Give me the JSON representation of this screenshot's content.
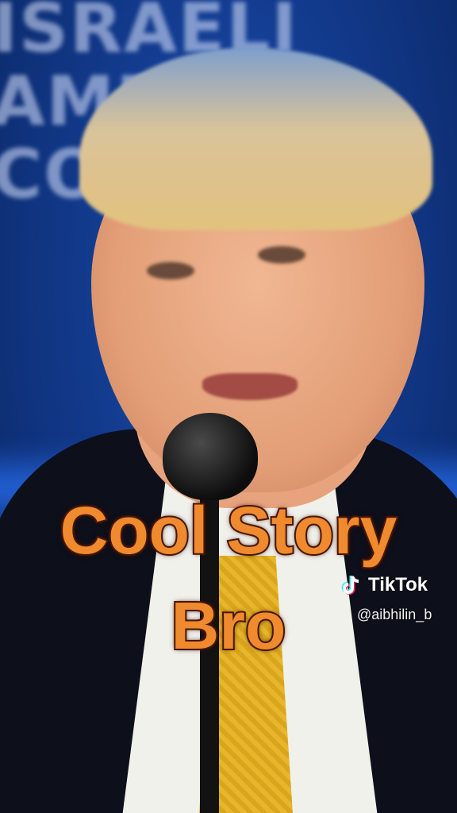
{
  "caption": {
    "line1": "Cool Story",
    "line2": "Bro",
    "fill_color": "#f08a2e",
    "stroke_color": "#4a1808"
  },
  "watermark": {
    "brand": "TikTok",
    "username": "@aibhilin_b",
    "icon": "tiktok-logo-icon"
  }
}
